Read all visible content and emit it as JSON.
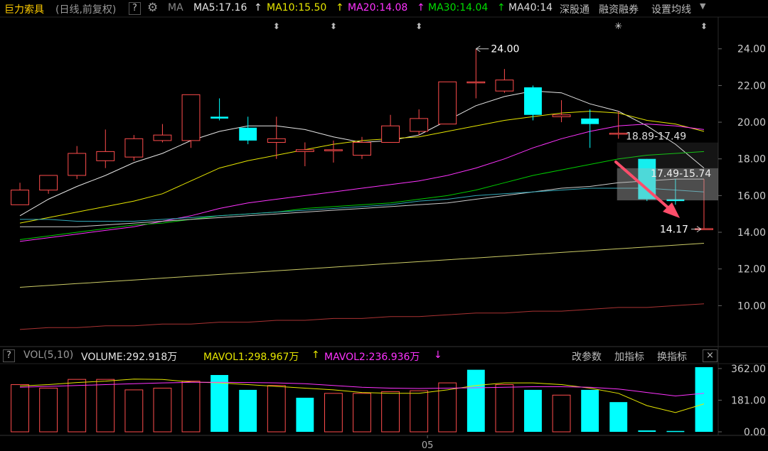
{
  "header": {
    "stock_name": "巨力索具",
    "period_label": "(日线,前复权)",
    "help_label": "?",
    "ma_label": "MA",
    "ma5": "MA5:17.16",
    "ma10": "MA10:15.50",
    "ma20": "MA20:14.08",
    "ma30": "MA30:14.04",
    "ma40": "MA40:14",
    "link_hsgt": "深股通",
    "link_margin": "融资融券",
    "settings": "设置均线"
  },
  "volume_header": {
    "help_label": "?",
    "indicator": "VOL(5,10)",
    "volume": "VOLUME:292.918万",
    "mavol1": "MAVOL1:298.967万",
    "mavol2": "MAVOL2:236.936万",
    "btn_params": "改参数",
    "btn_add": "加指标",
    "btn_switch": "换指标",
    "close_label": "×"
  },
  "colors": {
    "up": "#ff4d4d",
    "down": "#00ffff",
    "ma5": "#e6e6e6",
    "ma10": "#e6e600",
    "ma20": "#ff33ff",
    "ma30": "#00cc00",
    "ma40": "#cccccc",
    "ma_long_cyan": "#33aabb",
    "ma_long_yellow": "#cccc66",
    "ma_long_red": "#aa3333"
  },
  "chart_data": [
    {
      "type": "candlestick",
      "title": "巨力索具 (日线,前复权)",
      "y_ticks": [
        "24.00",
        "22.00",
        "20.00",
        "18.00",
        "16.00",
        "14.00",
        "12.00",
        "10.00"
      ],
      "ylim": [
        8.0,
        25.5
      ],
      "x_tick_labels": [
        "05"
      ],
      "annotations": {
        "high_label": "24.00",
        "low_label": "14.17",
        "range_upper": "18.89-17.49",
        "range_lower": "17.49-15.74"
      },
      "candles": [
        {
          "o": 15.5,
          "c": 16.3,
          "h": 16.7,
          "l": 15.5
        },
        {
          "o": 16.3,
          "c": 17.1,
          "h": 17.1,
          "l": 16.1
        },
        {
          "o": 17.1,
          "c": 18.3,
          "h": 18.7,
          "l": 16.9
        },
        {
          "o": 17.9,
          "c": 18.4,
          "h": 19.6,
          "l": 17.5
        },
        {
          "o": 18.1,
          "c": 19.1,
          "h": 19.3,
          "l": 17.9
        },
        {
          "o": 19.0,
          "c": 19.3,
          "h": 19.9,
          "l": 18.9
        },
        {
          "o": 19.0,
          "c": 21.5,
          "h": 21.5,
          "l": 18.6
        },
        {
          "o": 20.3,
          "c": 20.2,
          "h": 21.3,
          "l": 20.1
        },
        {
          "o": 19.7,
          "c": 19.0,
          "h": 20.3,
          "l": 18.8
        },
        {
          "o": 18.9,
          "c": 19.1,
          "h": 20.3,
          "l": 18.0
        },
        {
          "o": 18.4,
          "c": 18.5,
          "h": 18.9,
          "l": 17.6
        },
        {
          "o": 18.5,
          "c": 18.5,
          "h": 19.0,
          "l": 17.8
        },
        {
          "o": 18.2,
          "c": 18.9,
          "h": 19.2,
          "l": 18.0
        },
        {
          "o": 18.9,
          "c": 19.8,
          "h": 20.4,
          "l": 18.9
        },
        {
          "o": 19.5,
          "c": 20.2,
          "h": 20.7,
          "l": 19.3
        },
        {
          "o": 19.9,
          "c": 22.2,
          "h": 22.2,
          "l": 19.9
        },
        {
          "o": 22.2,
          "c": 22.2,
          "h": 24.0,
          "l": 21.3
        },
        {
          "o": 21.7,
          "c": 22.3,
          "h": 22.9,
          "l": 21.6
        },
        {
          "o": 21.9,
          "c": 20.4,
          "h": 22.0,
          "l": 20.1
        },
        {
          "o": 20.3,
          "c": 20.4,
          "h": 21.2,
          "l": 20.0
        },
        {
          "o": 20.2,
          "c": 19.9,
          "h": 20.7,
          "l": 18.6
        },
        {
          "o": 19.4,
          "c": 19.4,
          "h": 20.6,
          "l": 19.1
        },
        {
          "o": 18.0,
          "c": 15.8,
          "h": 18.0,
          "l": 15.7
        },
        {
          "o": 15.8,
          "c": 15.7,
          "h": 16.9,
          "l": 15.5
        },
        {
          "o": 14.2,
          "c": 14.2,
          "h": 16.9,
          "l": 14.17
        }
      ],
      "ma_lines": [
        {
          "name": "MA5",
          "color": "#e6e6e6",
          "values": [
            14.9,
            15.8,
            16.5,
            17.1,
            17.8,
            18.3,
            19.0,
            19.5,
            19.8,
            19.8,
            19.6,
            19.2,
            18.9,
            19.0,
            19.3,
            20.1,
            20.9,
            21.4,
            21.7,
            21.6,
            21.0,
            20.6,
            19.8,
            18.8,
            17.5
          ]
        },
        {
          "name": "MA10",
          "color": "#e6e600",
          "values": [
            14.5,
            14.8,
            15.1,
            15.4,
            15.7,
            16.1,
            16.8,
            17.5,
            17.9,
            18.2,
            18.5,
            18.8,
            19.0,
            19.1,
            19.2,
            19.5,
            19.8,
            20.1,
            20.3,
            20.5,
            20.6,
            20.5,
            20.1,
            19.9,
            19.5
          ]
        },
        {
          "name": "MA20",
          "color": "#ff33ff",
          "values": [
            13.5,
            13.7,
            13.9,
            14.1,
            14.3,
            14.6,
            14.9,
            15.3,
            15.6,
            15.8,
            16.0,
            16.2,
            16.4,
            16.6,
            16.8,
            17.1,
            17.5,
            18.0,
            18.6,
            19.1,
            19.5,
            19.8,
            19.9,
            19.8,
            19.6
          ]
        },
        {
          "name": "MA30",
          "color": "#00cc00",
          "values": [
            13.6,
            13.8,
            14.0,
            14.2,
            14.4,
            14.5,
            14.7,
            14.9,
            15.0,
            15.1,
            15.3,
            15.4,
            15.5,
            15.6,
            15.8,
            16.0,
            16.3,
            16.7,
            17.1,
            17.4,
            17.7,
            18.0,
            18.2,
            18.3,
            18.4
          ]
        },
        {
          "name": "MA40",
          "color": "#cccccc",
          "values": [
            14.3,
            14.3,
            14.3,
            14.4,
            14.5,
            14.6,
            14.7,
            14.8,
            14.9,
            15.0,
            15.1,
            15.2,
            15.3,
            15.4,
            15.5,
            15.6,
            15.8,
            16.0,
            16.2,
            16.4,
            16.5,
            16.7,
            16.8,
            16.9,
            16.9
          ]
        },
        {
          "name": "MA60",
          "color": "#33aabb",
          "values": [
            14.7,
            14.7,
            14.6,
            14.6,
            14.6,
            14.7,
            14.8,
            14.9,
            15.0,
            15.1,
            15.2,
            15.3,
            15.4,
            15.5,
            15.7,
            15.8,
            16.0,
            16.1,
            16.2,
            16.3,
            16.4,
            16.4,
            16.4,
            16.3,
            16.2
          ]
        },
        {
          "name": "MA120",
          "color": "#cccc66",
          "values": [
            11.0,
            11.1,
            11.2,
            11.3,
            11.4,
            11.5,
            11.6,
            11.7,
            11.8,
            11.9,
            12.0,
            12.1,
            12.2,
            12.3,
            12.4,
            12.5,
            12.6,
            12.7,
            12.8,
            12.9,
            13.0,
            13.1,
            13.2,
            13.3,
            13.4
          ]
        },
        {
          "name": "MA250",
          "color": "#aa3333",
          "values": [
            8.7,
            8.8,
            8.8,
            8.9,
            8.9,
            9.0,
            9.0,
            9.1,
            9.1,
            9.2,
            9.2,
            9.3,
            9.3,
            9.4,
            9.4,
            9.5,
            9.6,
            9.6,
            9.7,
            9.7,
            9.8,
            9.9,
            9.9,
            10.0,
            10.1
          ]
        }
      ]
    },
    {
      "type": "bar",
      "title": "VOL(5,10)",
      "y_ticks": [
        "362.00",
        "181.00",
        "0.00"
      ],
      "ylim": [
        0,
        390
      ],
      "unit": "万",
      "values": [
        270,
        250,
        300,
        300,
        240,
        250,
        290,
        325,
        240,
        265,
        195,
        220,
        220,
        230,
        235,
        280,
        355,
        270,
        240,
        210,
        240,
        170,
        8,
        5,
        370
      ],
      "up": [
        true,
        true,
        true,
        true,
        true,
        true,
        true,
        false,
        false,
        true,
        false,
        true,
        true,
        true,
        true,
        true,
        false,
        true,
        false,
        true,
        false,
        false,
        false,
        false,
        false
      ],
      "mavol1": [
        262,
        270,
        282,
        290,
        302,
        300,
        285,
        280,
        270,
        260,
        250,
        240,
        225,
        220,
        220,
        240,
        265,
        280,
        280,
        270,
        250,
        220,
        150,
        110,
        160
      ],
      "mavol2": [
        255,
        260,
        265,
        270,
        275,
        280,
        283,
        283,
        282,
        280,
        275,
        265,
        255,
        250,
        248,
        250,
        252,
        255,
        258,
        258,
        255,
        245,
        225,
        205,
        220
      ]
    }
  ]
}
